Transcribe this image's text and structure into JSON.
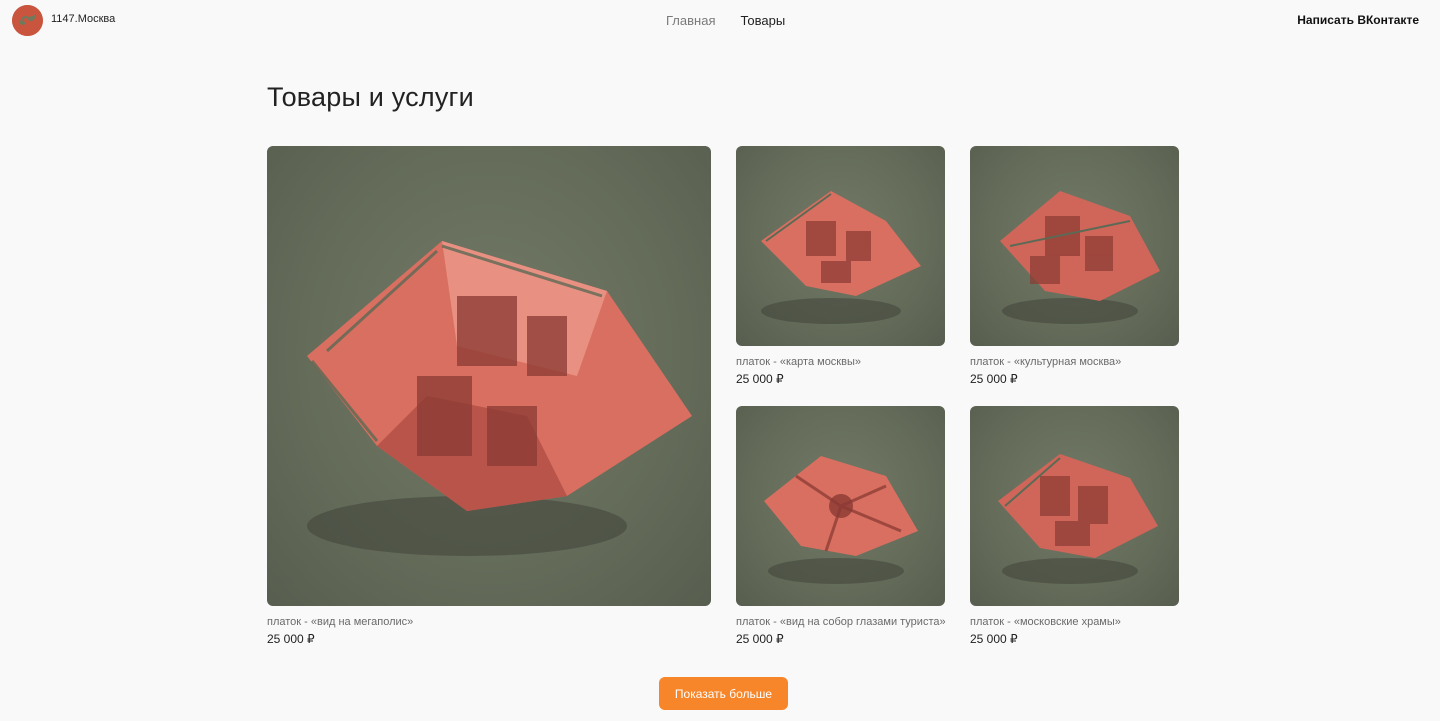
{
  "header": {
    "brand": "1147.Москва",
    "nav": {
      "home": "Главная",
      "goods": "Товары"
    },
    "contact": "Написать ВКонтакте"
  },
  "page": {
    "title": "Товары и услуги"
  },
  "products": [
    {
      "name": "платок - «вид на мегаполис»",
      "price": "25 000 ₽"
    },
    {
      "name": "платок - «карта москвы»",
      "price": "25 000 ₽"
    },
    {
      "name": "платок - «культурная москва»",
      "price": "25 000 ₽"
    },
    {
      "name": "платок - «вид на собор глазами туриста»",
      "price": "25 000 ₽"
    },
    {
      "name": "платок - «московские храмы»",
      "price": "25 000 ₽"
    }
  ],
  "actions": {
    "show_more": "Показать больше"
  },
  "colors": {
    "accent": "#f7862a",
    "scarf": "#d9705f",
    "background_photo": "#666d5b"
  }
}
